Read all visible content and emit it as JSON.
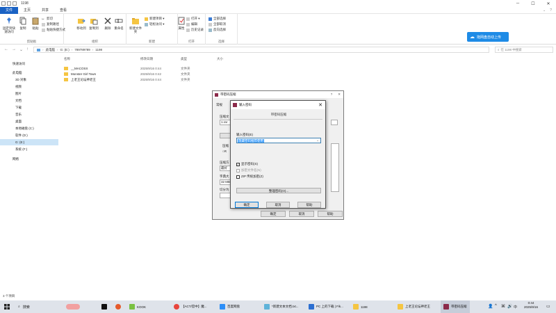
{
  "window": {
    "title": "1198",
    "tabs": [
      "文件",
      "主页",
      "共享",
      "查看"
    ]
  },
  "ribbon": {
    "groups": [
      {
        "label": "剪贴板",
        "buttons": [
          "固定到快速访问",
          "复制",
          "粘贴"
        ],
        "small": [
          "剪切",
          "复制路径",
          "粘贴快捷方式"
        ]
      },
      {
        "label": "组织",
        "buttons": [
          "移动到",
          "复制到",
          "删除",
          "重命名"
        ]
      },
      {
        "label": "新建",
        "buttons": [
          "新建文件夹"
        ],
        "small": [
          "新建项目 ▾",
          "轻松访问 ▾"
        ]
      },
      {
        "label": "打开",
        "buttons": [
          "属性"
        ],
        "small": [
          "打开 ▾",
          "编辑",
          "历史记录"
        ]
      },
      {
        "label": "选择",
        "small": [
          "全部选择",
          "全部取消",
          "反向选择"
        ]
      }
    ],
    "cloud_button": "拖网盘自动上传"
  },
  "address": {
    "crumbs": [
      "此电脑",
      "G: (E:)",
      "789789789",
      "1198"
    ],
    "search_placeholder": "在 1198 中搜索"
  },
  "nav_pane": {
    "items": [
      "快速访问",
      "此电脑",
      "3D 对象",
      "视频",
      "图片",
      "文档",
      "下载",
      "音乐",
      "桌面",
      "本地磁盘 (C:)",
      "软件 (D:)",
      "G: (E:)",
      "系统 (F:)",
      "网络"
    ],
    "selected": "G: (E:)"
  },
  "file_list": {
    "columns": [
      "名称",
      "修改日期",
      "类型",
      "大小"
    ],
    "rows": [
      {
        "name": "__MACOSX",
        "date": "2025/9/16 0:44",
        "type": "文件夹"
      },
      {
        "name": "Monster Girl Town",
        "date": "2025/9/16 0:42",
        "type": "文件夹"
      },
      {
        "name": "上老王论坛神老王",
        "date": "2025/9/16 0:44",
        "type": "文件夹"
      }
    ]
  },
  "status": "3 个项目",
  "bg_dialog": {
    "title": "带密码压缩",
    "tab": "常规",
    "labels": [
      "压缩文",
      "压缩",
      "压缩方",
      "字典大",
      "切分为"
    ],
    "field_values": [
      "1.rar",
      "最好",
      "32 MB"
    ],
    "buttons": [
      "确定",
      "取消",
      "帮助"
    ]
  },
  "dialog": {
    "title": "输入密码",
    "subtitle": "带密码压缩",
    "label": "输入密码(E)",
    "password_value": "隐藏密码推荐使用",
    "checkboxes": [
      {
        "label": "显示密码(S)",
        "checked": true,
        "disabled": false
      },
      {
        "label": "加密文件名(N)",
        "checked": false,
        "disabled": true
      },
      {
        "label": "ZIP 传统加密(Z)",
        "checked": false,
        "disabled": false
      }
    ],
    "organize_button": "整理密码(O)...",
    "ok": "确定",
    "cancel": "取消",
    "help": "帮助"
  },
  "taskbar": {
    "search": "搜索",
    "items": [
      "KOOK",
      "【ACT/官中】魔...",
      "百度网盘",
      "*新建文本文档.txt...",
      "PC 上的下载 | Fik...",
      "1198",
      "上老王论坛神老王",
      "带密码压缩"
    ],
    "active": "带密码压缩",
    "time": "0:44",
    "date": "2025/9/16",
    "ime": "中"
  },
  "colors": {
    "accent": "#1a62c4",
    "cloud": "#1e8be6",
    "selection": "#cce4f7",
    "highlight": "#3399ff"
  }
}
